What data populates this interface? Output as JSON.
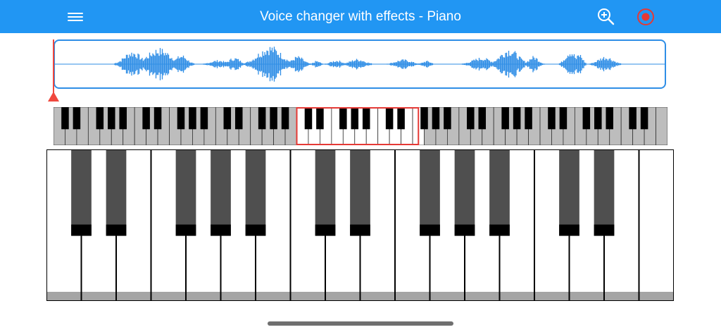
{
  "header": {
    "title": "Voice changer with effects - Piano",
    "icons": {
      "menu": "hamburger-menu-icon",
      "zoom": "zoom-in-icon",
      "record": "record-icon"
    }
  },
  "waveform": {
    "playhead_progress": 0
  },
  "keyboard": {
    "mini_total_octaves": 7.5,
    "selected_range_start_octave": 3,
    "selected_range_octaves": 1.5,
    "main_octaves": 2.5
  },
  "colors": {
    "accent": "#2196f3",
    "waveform": "#2f8ee6",
    "playhead": "#f0483e",
    "selection": "#e53935",
    "black_key": "#4f4f4f",
    "black_key_tip": "#000000",
    "white_key_shade": "#a5a5a5",
    "inactive_white_key": "#bdbdbd"
  }
}
